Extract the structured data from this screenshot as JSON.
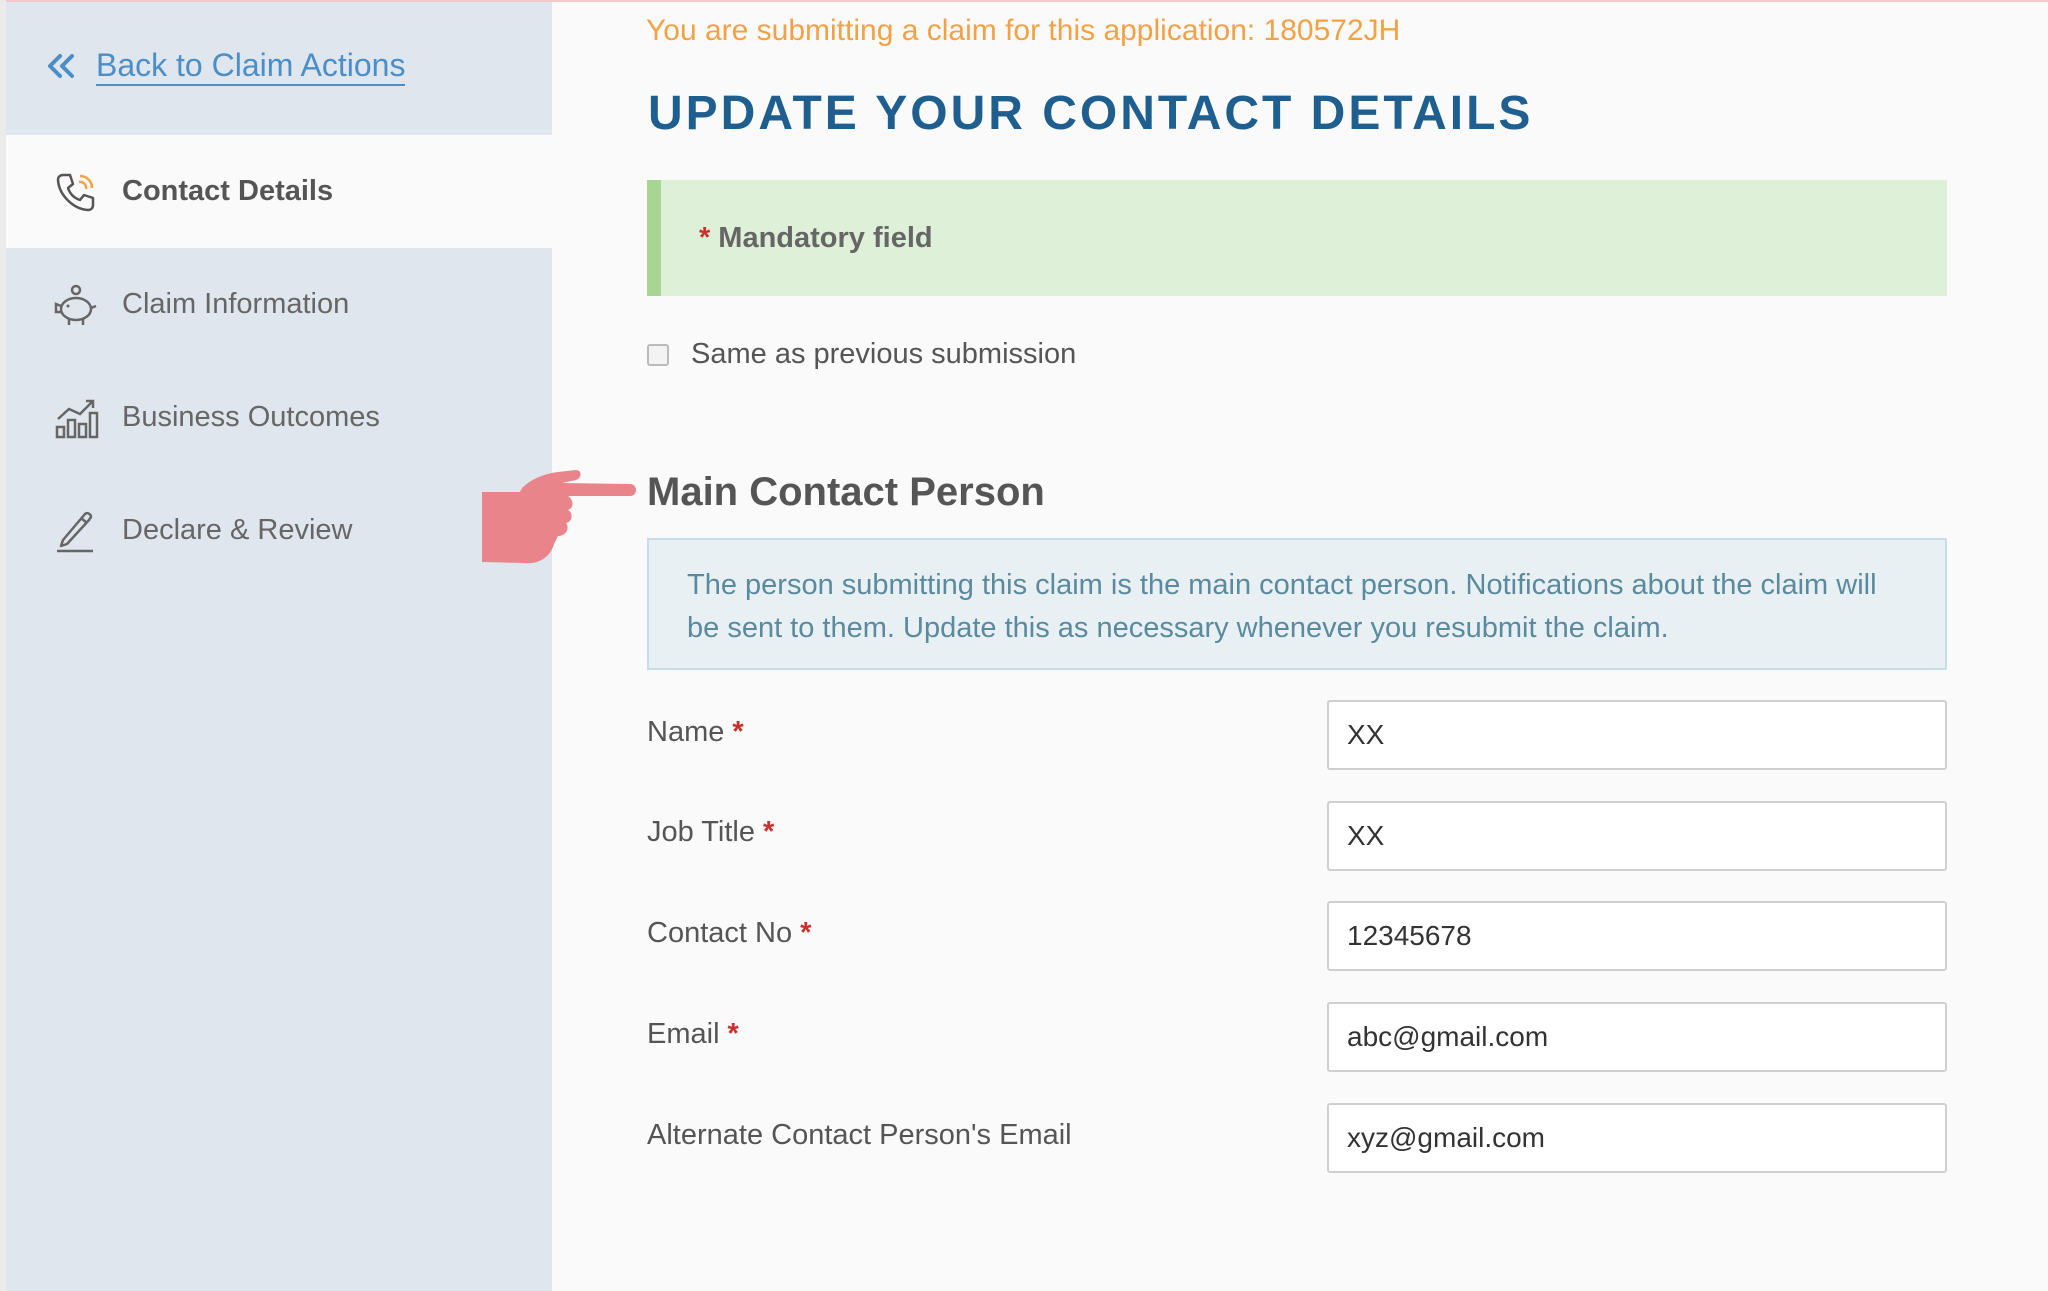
{
  "sidebar": {
    "back_label": "Back to Claim Actions",
    "items": [
      {
        "label": "Contact Details",
        "icon": "phone-icon",
        "active": true
      },
      {
        "label": "Claim Information",
        "icon": "piggy-bank-icon",
        "active": false
      },
      {
        "label": "Business Outcomes",
        "icon": "bar-chart-icon",
        "active": false
      },
      {
        "label": "Declare & Review",
        "icon": "pen-icon",
        "active": false
      }
    ]
  },
  "main": {
    "notice": "You are submitting a claim for this application: 180572JH",
    "title": "UPDATE YOUR CONTACT DETAILS",
    "mandatory_marker": "*",
    "mandatory_label": "Mandatory field",
    "same_as_previous": "Same as previous submission",
    "section_title": "Main Contact Person",
    "info_text": "The person submitting this claim is the main contact person. Notifications about the claim will be sent to them. Update this as necessary whenever you resubmit the claim.",
    "fields": [
      {
        "label": "Name",
        "required_marker": "*",
        "value": "XX"
      },
      {
        "label": "Job Title",
        "required_marker": "*",
        "value": "XX"
      },
      {
        "label": "Contact No",
        "required_marker": "*",
        "value": "12345678"
      },
      {
        "label": "Email",
        "required_marker": "*",
        "value": "abc@gmail.com"
      },
      {
        "label": "Alternate Contact Person's Email",
        "value": "xyz@gmail.com"
      }
    ]
  },
  "colors": {
    "notice": "#f2a245",
    "title": "#1f5f90",
    "link": "#4a8fc9",
    "required": "#c9302c",
    "mandatory_bg": "#dff0d8",
    "pointer_hand": "#e8848a"
  }
}
